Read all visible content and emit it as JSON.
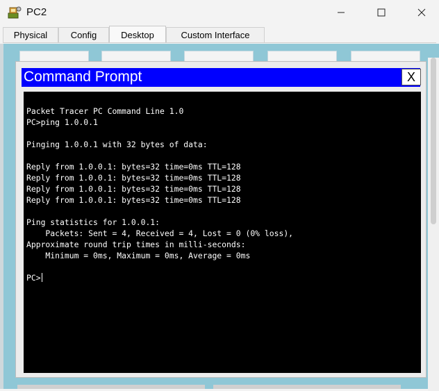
{
  "window": {
    "title": "PC2",
    "icon": "packet-tracer-pc-icon"
  },
  "tabs": [
    {
      "label": "Physical",
      "active": false
    },
    {
      "label": "Config",
      "active": false
    },
    {
      "label": "Desktop",
      "active": true
    },
    {
      "label": "Custom Interface",
      "active": false
    }
  ],
  "command_prompt": {
    "title": "Command Prompt",
    "close_label": "X",
    "lines": [
      "Packet Tracer PC Command Line 1.0",
      "PC>ping 1.0.0.1",
      "",
      "Pinging 1.0.0.1 with 32 bytes of data:",
      "",
      "Reply from 1.0.0.1: bytes=32 time=0ms TTL=128",
      "Reply from 1.0.0.1: bytes=32 time=0ms TTL=128",
      "Reply from 1.0.0.1: bytes=32 time=0ms TTL=128",
      "Reply from 1.0.0.1: bytes=32 time=0ms TTL=128",
      "",
      "Ping statistics for 1.0.0.1:",
      "    Packets: Sent = 4, Received = 4, Lost = 0 (0% loss),",
      "Approximate round trip times in milli-seconds:",
      "    Minimum = 0ms, Maximum = 0ms, Average = 0ms",
      ""
    ],
    "prompt": "PC>"
  },
  "colors": {
    "cmd_title_bar": "#0000ff",
    "terminal_bg": "#000000",
    "terminal_text": "#ffffff",
    "desktop_bg": "#8fc7d6"
  }
}
